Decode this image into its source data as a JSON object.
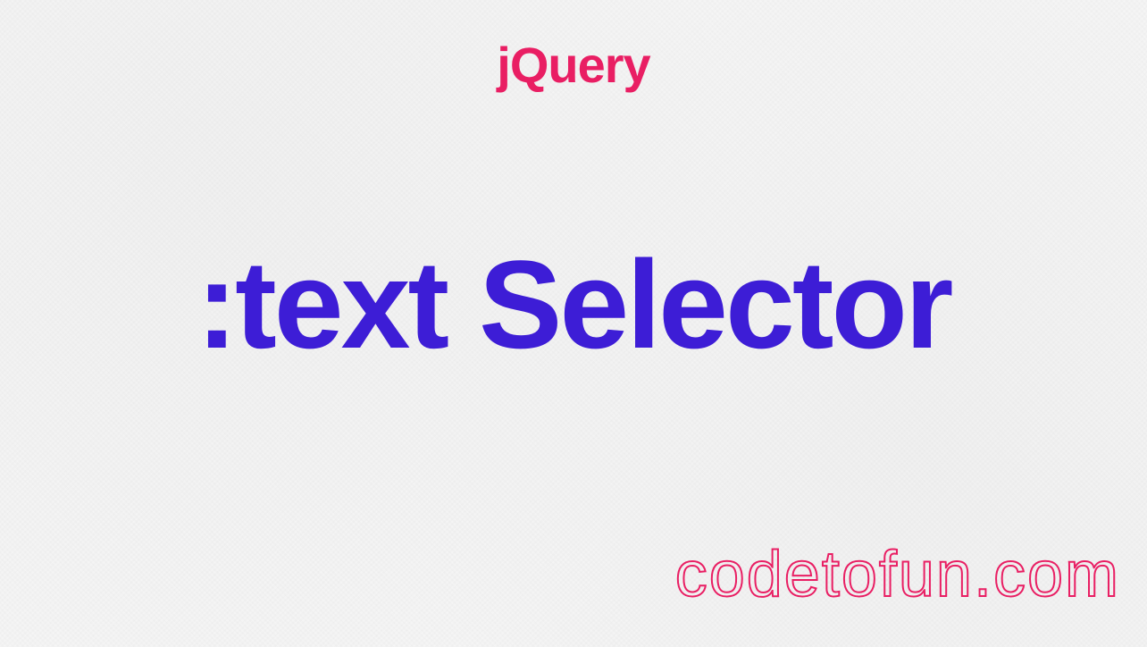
{
  "header": {
    "title": "jQuery"
  },
  "main": {
    "title": ":text Selector"
  },
  "footer": {
    "website": "codetofun.com"
  },
  "colors": {
    "header_color": "#e91e63",
    "main_color": "#3d1dd6",
    "footer_stroke": "#e91e63",
    "background": "#f5f5f5"
  }
}
